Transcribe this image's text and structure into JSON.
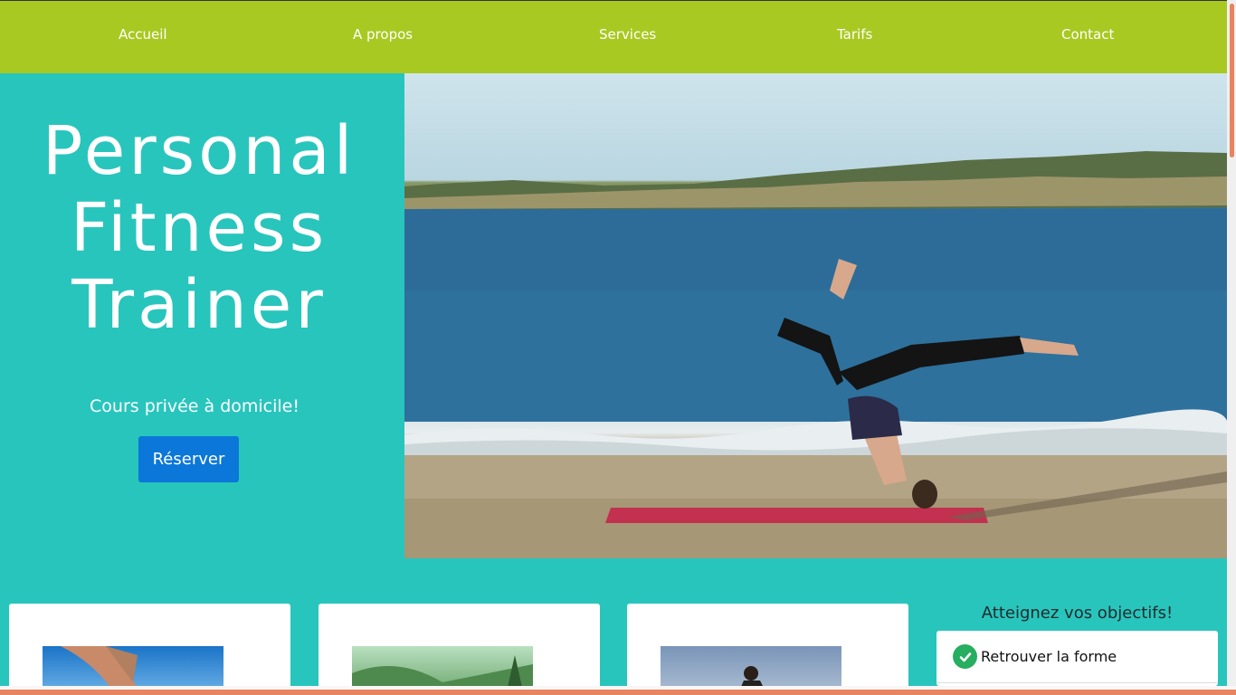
{
  "nav": {
    "items": [
      {
        "label": "Accueil"
      },
      {
        "label": "A propos"
      },
      {
        "label": "Services"
      },
      {
        "label": "Tarifs"
      },
      {
        "label": "Contact"
      }
    ]
  },
  "hero": {
    "title_line1": "Personal",
    "title_line2": "Fitness",
    "title_line3": "Trainer",
    "subtitle": "Cours privée à domicile!",
    "cta_label": "Réserver",
    "image_icon": "yoga-beach-photo"
  },
  "cards": [
    {
      "image_icon": "runner-photo"
    },
    {
      "image_icon": "mountain-photo"
    },
    {
      "image_icon": "fitness-photo"
    }
  ],
  "goals": {
    "title": "Atteignez vos objectifs!",
    "items": [
      {
        "label": "Retrouver la forme",
        "icon": "check-circle-icon"
      }
    ]
  },
  "colors": {
    "nav_bg": "#a8c922",
    "page_bg": "#28c5bd",
    "cta_bg": "#0b77d8",
    "check": "#27ae60",
    "scroll_accent": "#e8845f"
  }
}
